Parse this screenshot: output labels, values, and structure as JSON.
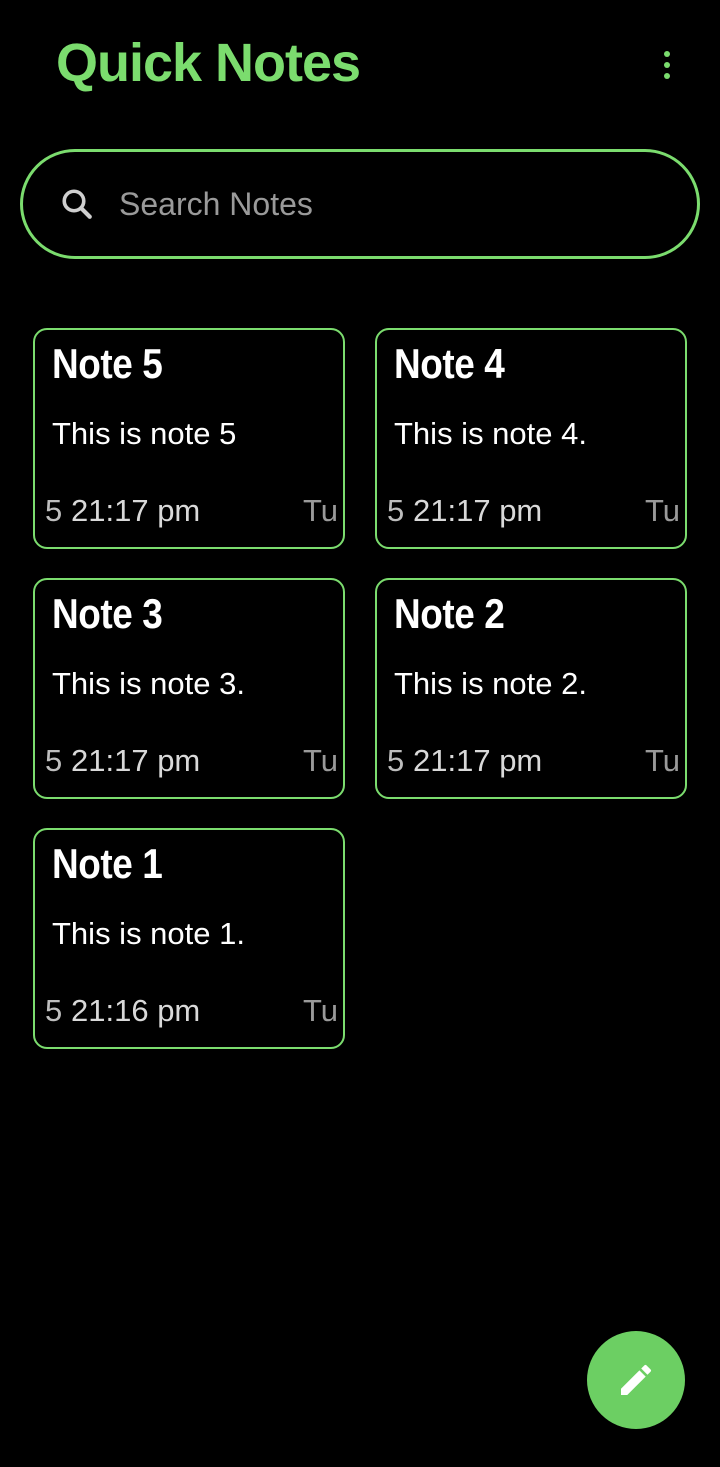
{
  "header": {
    "title": "Quick Notes",
    "menu_icon": "more-vertical-icon"
  },
  "search": {
    "placeholder": "Search Notes",
    "value": "",
    "icon": "search-icon"
  },
  "notes": [
    {
      "title": "Note 5",
      "body": "This is note 5",
      "lead": "5",
      "time": "21:17 pm",
      "trail": "Tu"
    },
    {
      "title": "Note 4",
      "body": "This is note 4.",
      "lead": "5",
      "time": "21:17 pm",
      "trail": "Tu"
    },
    {
      "title": "Note 3",
      "body": "This is note 3.",
      "lead": "5",
      "time": "21:17 pm",
      "trail": "Tu"
    },
    {
      "title": "Note 2",
      "body": "This is note 2.",
      "lead": "5",
      "time": "21:17 pm",
      "trail": "Tu"
    },
    {
      "title": "Note 1",
      "body": "This is note 1.",
      "lead": "5",
      "time": "21:16 pm",
      "trail": "Tu"
    }
  ],
  "fab": {
    "icon": "pencil-icon"
  },
  "colors": {
    "accent": "#7bdc6e",
    "fab": "#6ccf63",
    "background": "#000000",
    "text": "#ffffff"
  }
}
